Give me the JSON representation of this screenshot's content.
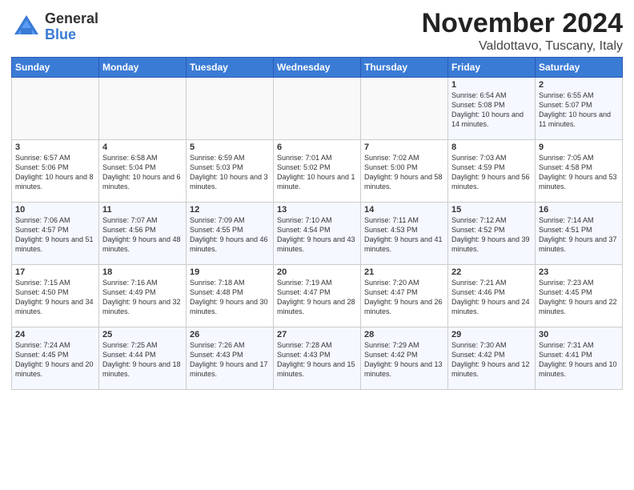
{
  "header": {
    "logo_general": "General",
    "logo_blue": "Blue",
    "month": "November 2024",
    "location": "Valdottavo, Tuscany, Italy"
  },
  "days_of_week": [
    "Sunday",
    "Monday",
    "Tuesday",
    "Wednesday",
    "Thursday",
    "Friday",
    "Saturday"
  ],
  "weeks": [
    [
      {
        "day": "",
        "info": ""
      },
      {
        "day": "",
        "info": ""
      },
      {
        "day": "",
        "info": ""
      },
      {
        "day": "",
        "info": ""
      },
      {
        "day": "",
        "info": ""
      },
      {
        "day": "1",
        "info": "Sunrise: 6:54 AM\nSunset: 5:08 PM\nDaylight: 10 hours and 14 minutes."
      },
      {
        "day": "2",
        "info": "Sunrise: 6:55 AM\nSunset: 5:07 PM\nDaylight: 10 hours and 11 minutes."
      }
    ],
    [
      {
        "day": "3",
        "info": "Sunrise: 6:57 AM\nSunset: 5:06 PM\nDaylight: 10 hours and 8 minutes."
      },
      {
        "day": "4",
        "info": "Sunrise: 6:58 AM\nSunset: 5:04 PM\nDaylight: 10 hours and 6 minutes."
      },
      {
        "day": "5",
        "info": "Sunrise: 6:59 AM\nSunset: 5:03 PM\nDaylight: 10 hours and 3 minutes."
      },
      {
        "day": "6",
        "info": "Sunrise: 7:01 AM\nSunset: 5:02 PM\nDaylight: 10 hours and 1 minute."
      },
      {
        "day": "7",
        "info": "Sunrise: 7:02 AM\nSunset: 5:00 PM\nDaylight: 9 hours and 58 minutes."
      },
      {
        "day": "8",
        "info": "Sunrise: 7:03 AM\nSunset: 4:59 PM\nDaylight: 9 hours and 56 minutes."
      },
      {
        "day": "9",
        "info": "Sunrise: 7:05 AM\nSunset: 4:58 PM\nDaylight: 9 hours and 53 minutes."
      }
    ],
    [
      {
        "day": "10",
        "info": "Sunrise: 7:06 AM\nSunset: 4:57 PM\nDaylight: 9 hours and 51 minutes."
      },
      {
        "day": "11",
        "info": "Sunrise: 7:07 AM\nSunset: 4:56 PM\nDaylight: 9 hours and 48 minutes."
      },
      {
        "day": "12",
        "info": "Sunrise: 7:09 AM\nSunset: 4:55 PM\nDaylight: 9 hours and 46 minutes."
      },
      {
        "day": "13",
        "info": "Sunrise: 7:10 AM\nSunset: 4:54 PM\nDaylight: 9 hours and 43 minutes."
      },
      {
        "day": "14",
        "info": "Sunrise: 7:11 AM\nSunset: 4:53 PM\nDaylight: 9 hours and 41 minutes."
      },
      {
        "day": "15",
        "info": "Sunrise: 7:12 AM\nSunset: 4:52 PM\nDaylight: 9 hours and 39 minutes."
      },
      {
        "day": "16",
        "info": "Sunrise: 7:14 AM\nSunset: 4:51 PM\nDaylight: 9 hours and 37 minutes."
      }
    ],
    [
      {
        "day": "17",
        "info": "Sunrise: 7:15 AM\nSunset: 4:50 PM\nDaylight: 9 hours and 34 minutes."
      },
      {
        "day": "18",
        "info": "Sunrise: 7:16 AM\nSunset: 4:49 PM\nDaylight: 9 hours and 32 minutes."
      },
      {
        "day": "19",
        "info": "Sunrise: 7:18 AM\nSunset: 4:48 PM\nDaylight: 9 hours and 30 minutes."
      },
      {
        "day": "20",
        "info": "Sunrise: 7:19 AM\nSunset: 4:47 PM\nDaylight: 9 hours and 28 minutes."
      },
      {
        "day": "21",
        "info": "Sunrise: 7:20 AM\nSunset: 4:47 PM\nDaylight: 9 hours and 26 minutes."
      },
      {
        "day": "22",
        "info": "Sunrise: 7:21 AM\nSunset: 4:46 PM\nDaylight: 9 hours and 24 minutes."
      },
      {
        "day": "23",
        "info": "Sunrise: 7:23 AM\nSunset: 4:45 PM\nDaylight: 9 hours and 22 minutes."
      }
    ],
    [
      {
        "day": "24",
        "info": "Sunrise: 7:24 AM\nSunset: 4:45 PM\nDaylight: 9 hours and 20 minutes."
      },
      {
        "day": "25",
        "info": "Sunrise: 7:25 AM\nSunset: 4:44 PM\nDaylight: 9 hours and 18 minutes."
      },
      {
        "day": "26",
        "info": "Sunrise: 7:26 AM\nSunset: 4:43 PM\nDaylight: 9 hours and 17 minutes."
      },
      {
        "day": "27",
        "info": "Sunrise: 7:28 AM\nSunset: 4:43 PM\nDaylight: 9 hours and 15 minutes."
      },
      {
        "day": "28",
        "info": "Sunrise: 7:29 AM\nSunset: 4:42 PM\nDaylight: 9 hours and 13 minutes."
      },
      {
        "day": "29",
        "info": "Sunrise: 7:30 AM\nSunset: 4:42 PM\nDaylight: 9 hours and 12 minutes."
      },
      {
        "day": "30",
        "info": "Sunrise: 7:31 AM\nSunset: 4:41 PM\nDaylight: 9 hours and 10 minutes."
      }
    ]
  ]
}
